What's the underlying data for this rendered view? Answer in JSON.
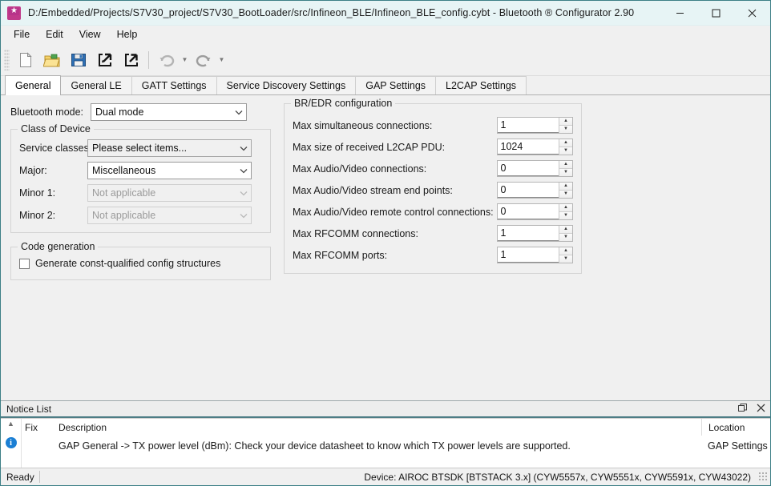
{
  "titlebar": {
    "title": "D:/Embedded/Projects/S7V30_project/S7V30_BootLoader/src/Infineon_BLE/Infineon_BLE_config.cybt - Bluetooth ® Configurator 2.90",
    "app_icon": "bluetooth-configurator-icon",
    "minimize": "minimize-icon",
    "maximize": "maximize-icon",
    "close": "close-icon"
  },
  "menubar": {
    "items": [
      {
        "label": "File"
      },
      {
        "label": "Edit"
      },
      {
        "label": "View"
      },
      {
        "label": "Help"
      }
    ]
  },
  "toolbar": {
    "buttons": [
      {
        "name": "new-file-icon",
        "tip": "New"
      },
      {
        "name": "open-folder-icon",
        "tip": "Open"
      },
      {
        "name": "save-icon",
        "tip": "Save"
      },
      {
        "name": "import-icon",
        "tip": "Import"
      },
      {
        "name": "export-icon",
        "tip": "Export"
      },
      {
        "name": "undo-icon",
        "tip": "Undo"
      },
      {
        "name": "redo-icon",
        "tip": "Redo"
      }
    ]
  },
  "tabs": [
    {
      "label": "General",
      "active": true
    },
    {
      "label": "General LE",
      "active": false
    },
    {
      "label": "GATT Settings",
      "active": false
    },
    {
      "label": "Service Discovery Settings",
      "active": false
    },
    {
      "label": "GAP Settings",
      "active": false
    },
    {
      "label": "L2CAP Settings",
      "active": false
    }
  ],
  "general_tab": {
    "bluetooth_mode": {
      "label": "Bluetooth mode:",
      "value": "Dual mode"
    },
    "class_of_device": {
      "title": "Class of Device",
      "fields": [
        {
          "label": "Service classes:",
          "value": "Please select items...",
          "state": "shaded"
        },
        {
          "label": "Major:",
          "value": "Miscellaneous",
          "state": "enabled"
        },
        {
          "label": "Minor 1:",
          "value": "Not applicable",
          "state": "disabled"
        },
        {
          "label": "Minor 2:",
          "value": "Not applicable",
          "state": "disabled"
        }
      ]
    },
    "code_generation": {
      "title": "Code generation",
      "checkbox_label": "Generate const-qualified config structures",
      "checked": false
    },
    "bredr_configuration": {
      "title": "BR/EDR configuration",
      "fields": [
        {
          "label": "Max simultaneous connections:",
          "value": "1"
        },
        {
          "label": "Max size of received L2CAP PDU:",
          "value": "1024"
        },
        {
          "label": "Max Audio/Video connections:",
          "value": "0"
        },
        {
          "label": "Max Audio/Video stream end points:",
          "value": "0"
        },
        {
          "label": "Max Audio/Video remote control connections:",
          "value": "0"
        },
        {
          "label": "Max RFCOMM connections:",
          "value": "1"
        },
        {
          "label": "Max RFCOMM ports:",
          "value": "1"
        }
      ]
    }
  },
  "notice_list": {
    "title": "Notice List",
    "float_icon": "float-window-icon",
    "close_icon": "close-icon",
    "columns": {
      "fix": "Fix",
      "description": "Description",
      "location": "Location"
    },
    "rows": [
      {
        "severity": "info",
        "fix": "",
        "description": "GAP General -> TX power level (dBm): Check your device datasheet to know which TX power levels are supported.",
        "location": "GAP Settings"
      }
    ]
  },
  "statusbar": {
    "left": "Ready",
    "right": "Device: AIROC BTSDK [BTSTACK 3.x] (CYW5557x, CYW5551x, CYW5591x, CYW43022)"
  },
  "colors": {
    "titlebar_bg": "#e7f4f5",
    "window_border": "#3d7f86",
    "content_bg": "#f0f0f0",
    "accent_underline": "#4e7d85",
    "info_blue": "#1b7fd4",
    "app_icon_pink": "#c0398a"
  }
}
